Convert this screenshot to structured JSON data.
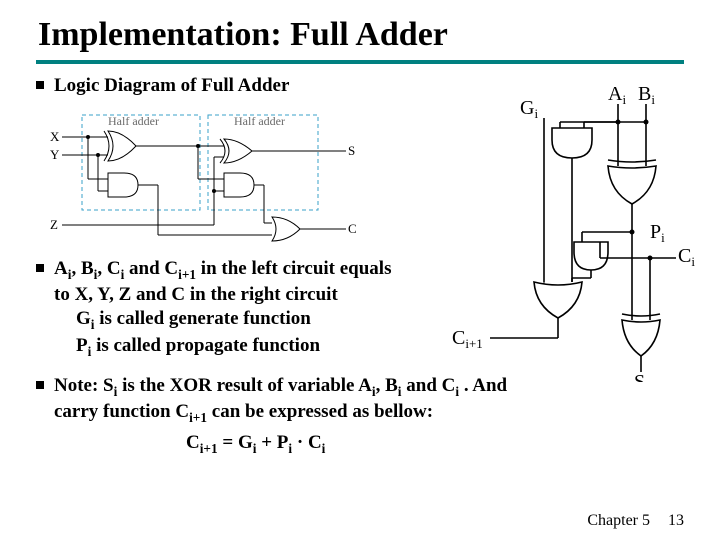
{
  "title": "Implementation: Full Adder",
  "bullets": {
    "b1": "Logic Diagram of Full Adder",
    "b2_l1": "A",
    "b2_l2": ", B",
    "b2_l3": ", C",
    "b2_l4": " and C",
    "b2_l5": " in the left circuit equals",
    "b2_line2a": "to X, Y, Z and C in the right circuit",
    "b2_line3a": "G",
    "b2_line3b": " is called generate function",
    "b2_line4a": "P",
    "b2_line4b": " is called propagate function",
    "b3_l1": "Note: S",
    "b3_l2": " is the XOR result of variable A",
    "b3_l3": ", B",
    "b3_l4": " and C",
    "b3_l5": " . And",
    "b3_line2a": "carry function C",
    "b3_line2b": " can be expressed as bellow:"
  },
  "subs": {
    "i": "i",
    "ip1": "i+1"
  },
  "eq": {
    "lhs": "C",
    "eq": " = G",
    "plus": " + P",
    "dot": " · C"
  },
  "left_diagram": {
    "ha": "Half adder",
    "X": "X",
    "Y": "Y",
    "Z": "Z",
    "S": "S",
    "C": "C"
  },
  "right_diagram": {
    "A": "A",
    "B": "B",
    "G": "G",
    "P": "P",
    "C": "C",
    "S": "S",
    "Cip1": "C"
  },
  "footer": {
    "chapter": "Chapter 5",
    "page": "13"
  }
}
